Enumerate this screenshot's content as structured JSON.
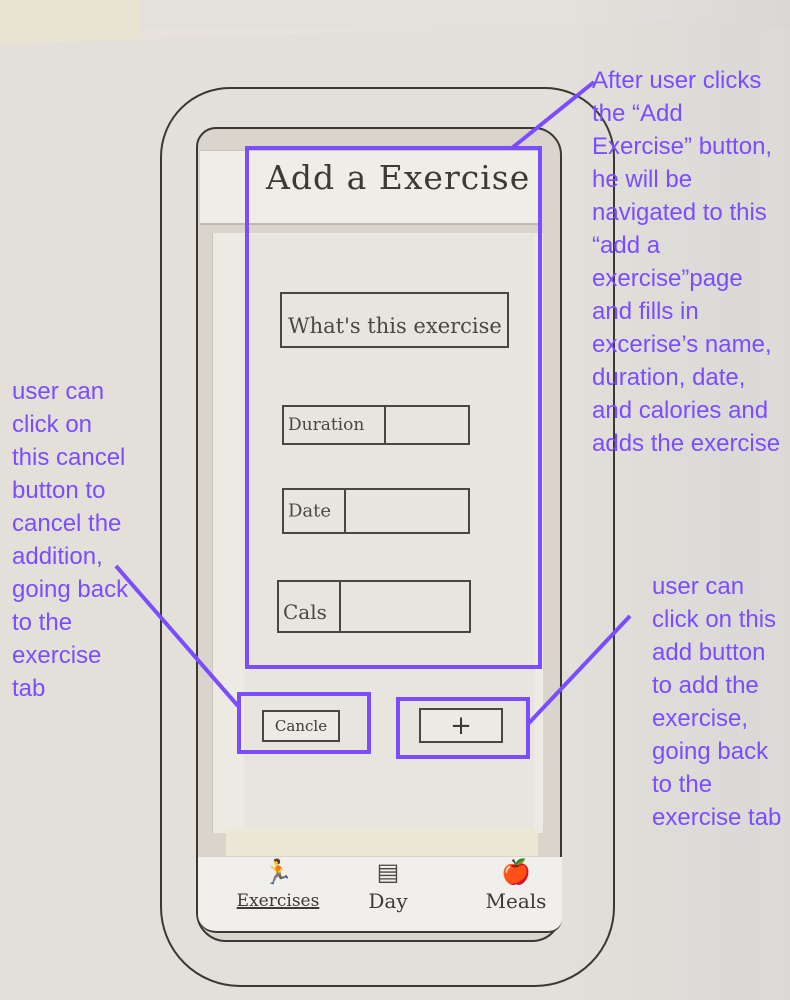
{
  "screen": {
    "title": "Add a Exercise",
    "fields": [
      {
        "name": "exercise-name",
        "label": "What's this exercise",
        "value": ""
      },
      {
        "name": "duration",
        "label": "Duration",
        "value": ""
      },
      {
        "name": "date",
        "label": "Date",
        "value": ""
      },
      {
        "name": "calories",
        "label": "Cals",
        "value": ""
      }
    ],
    "buttons": {
      "cancel_label": "Cancle",
      "add_label": "+"
    },
    "tabs": [
      {
        "id": "exercises",
        "label": "Exercises",
        "icon": "running-person-icon",
        "glyph": "🏃",
        "active": true
      },
      {
        "id": "day",
        "label": "Day",
        "icon": "list-document-icon",
        "glyph": "▤",
        "active": false
      },
      {
        "id": "meals",
        "label": "Meals",
        "icon": "food-icon",
        "glyph": "🍎",
        "active": false
      }
    ]
  },
  "annotations": {
    "color": "#7c4dff",
    "top_note": "After user clicks the “Add Exercise” button, he will be navigated to this “add a exercise”page and fills in excerise’s name, duration, date, and calories and adds the exercise",
    "cancel_note": "user can click on this cancel button to cancel the addition, going back to the exercise tab",
    "add_note": "user can click on this add button to add the exercise, going back to the exercise tab"
  }
}
